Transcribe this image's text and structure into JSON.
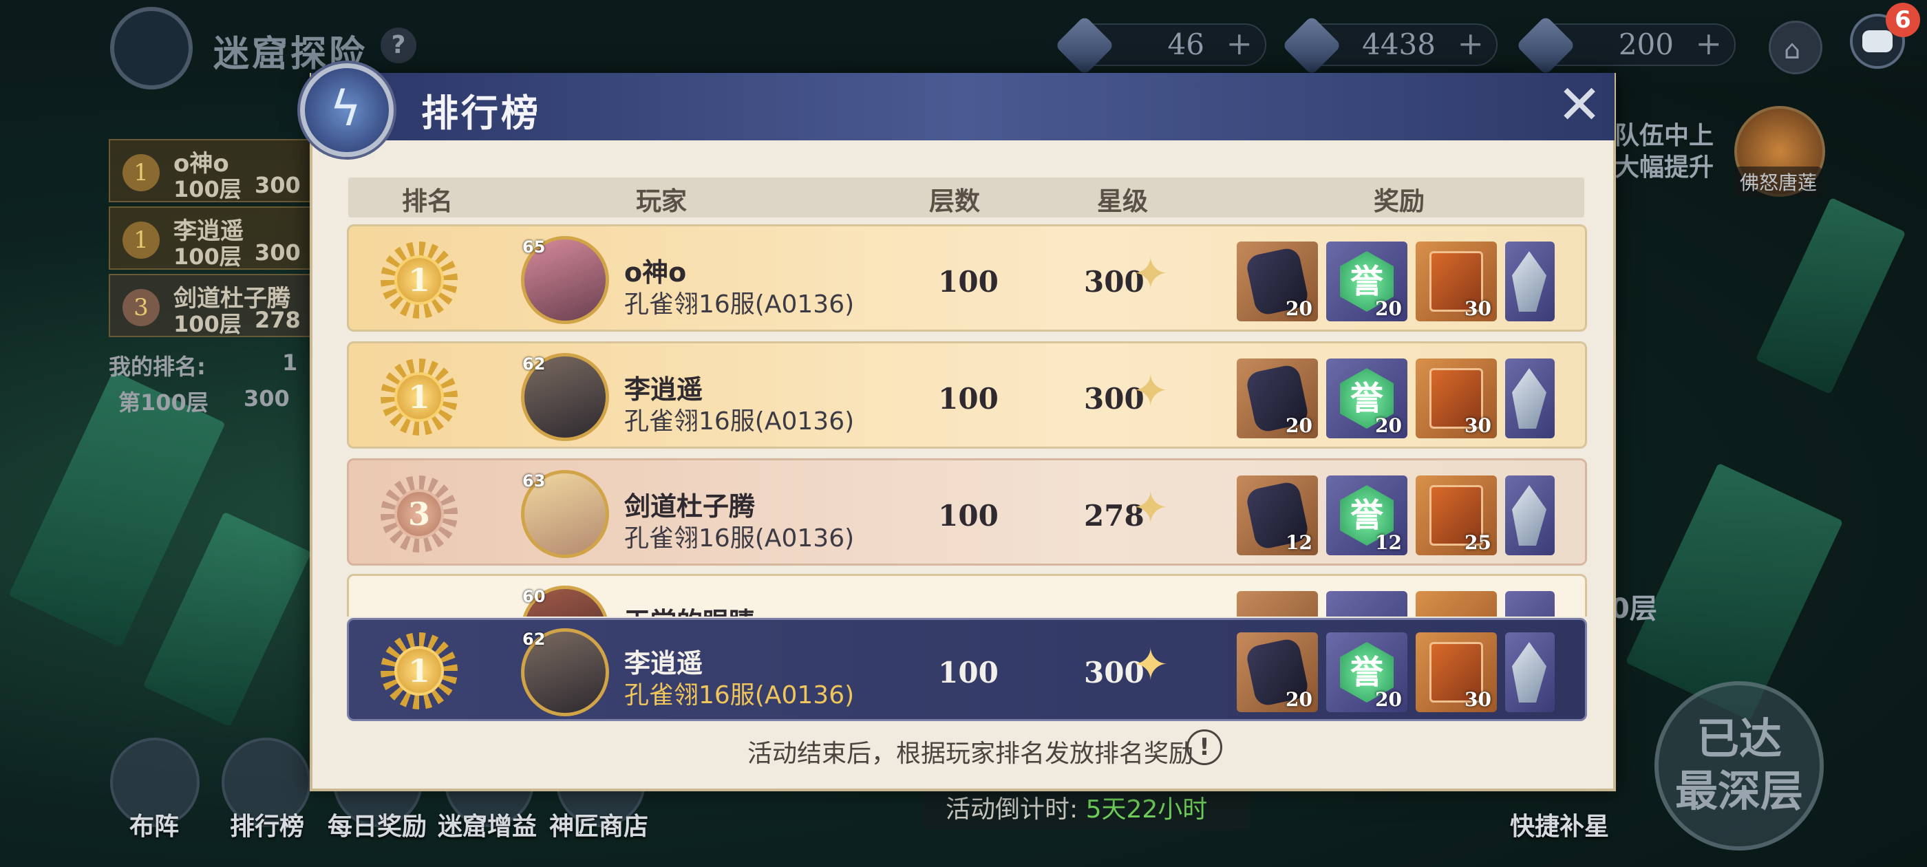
{
  "top_bar": {
    "title": "迷窟探险",
    "help_icon": "question-mark",
    "resources": [
      {
        "icon": "diamond-icon",
        "value": "46"
      },
      {
        "icon": "crystal-card-icon",
        "value": "4438"
      },
      {
        "icon": "blue-gem-icon",
        "value": "200"
      }
    ],
    "plus_glyph": "+",
    "chat_badge": "6"
  },
  "left_panel": {
    "entries": [
      {
        "rank": "1",
        "name": "o神o",
        "floor": "100层",
        "stars": "300"
      },
      {
        "rank": "1",
        "name": "李逍遥",
        "floor": "100层",
        "stars": "300"
      },
      {
        "rank": "3",
        "name": "剑道杜子腾",
        "floor": "100层",
        "stars": "278"
      }
    ],
    "my_rank_label": "我的排名:",
    "my_rank_value": "1",
    "floor100_label": "第100层",
    "floor100_value": "300"
  },
  "right_panel": {
    "hint_line1": "队伍中上",
    "hint_line2": "大幅提升",
    "boss_name": "佛怒唐莲",
    "floor_text": "0层",
    "deepest_line1": "已达",
    "deepest_line2": "最深层",
    "quick_star_label": "快捷补星"
  },
  "bottom_nav": [
    {
      "label": "布阵",
      "icon": "team-icon"
    },
    {
      "label": "排行榜",
      "icon": "trophy-icon"
    },
    {
      "label": "每日奖励",
      "icon": "gift-icon"
    },
    {
      "label": "迷窟增益",
      "icon": "buff-icon"
    },
    {
      "label": "神匠商店",
      "icon": "shop-icon"
    }
  ],
  "countdown": {
    "label": "活动倒计时:",
    "value": "5天22小时"
  },
  "modal": {
    "title": "排行榜",
    "close_glyph": "✕",
    "headers": {
      "rank": "排名",
      "player": "玩家",
      "floor": "层数",
      "stars": "星级",
      "rewards": "奖励"
    },
    "rows": [
      {
        "rank": "1",
        "level": "65",
        "name": "o神o",
        "server": "孔雀翎16服(A0136)",
        "floor": "100",
        "stars": "300",
        "rewards": [
          "20",
          "20",
          "30"
        ],
        "style": "gold"
      },
      {
        "rank": "1",
        "level": "62",
        "name": "李逍遥",
        "server": "孔雀翎16服(A0136)",
        "floor": "100",
        "stars": "300",
        "rewards": [
          "20",
          "20",
          "30"
        ],
        "style": "gold"
      },
      {
        "rank": "3",
        "level": "63",
        "name": "剑道杜子腾",
        "server": "孔雀翎16服(A0136)",
        "floor": "100",
        "stars": "278",
        "rewards": [
          "12",
          "12",
          "25"
        ],
        "style": "bronze"
      }
    ],
    "partial_row": {
      "level": "60",
      "name": "天堂的眼睛"
    },
    "my_row": {
      "rank": "1",
      "level": "62",
      "name": "李逍遥",
      "server": "孔雀翎16服(A0136)",
      "floor": "100",
      "stars": "300",
      "rewards": [
        "20",
        "20",
        "30"
      ]
    },
    "reward_gem_glyph": "誉",
    "star_glyph": "✦",
    "footnote": "活动结束后，根据玩家排名发放排名奖励",
    "info_glyph": "!"
  },
  "colors": {
    "accent_gold": "#d8a435",
    "header_navy": "#2a3565",
    "countdown_green": "#6fcf5a",
    "badge_red": "#e24b3a"
  }
}
